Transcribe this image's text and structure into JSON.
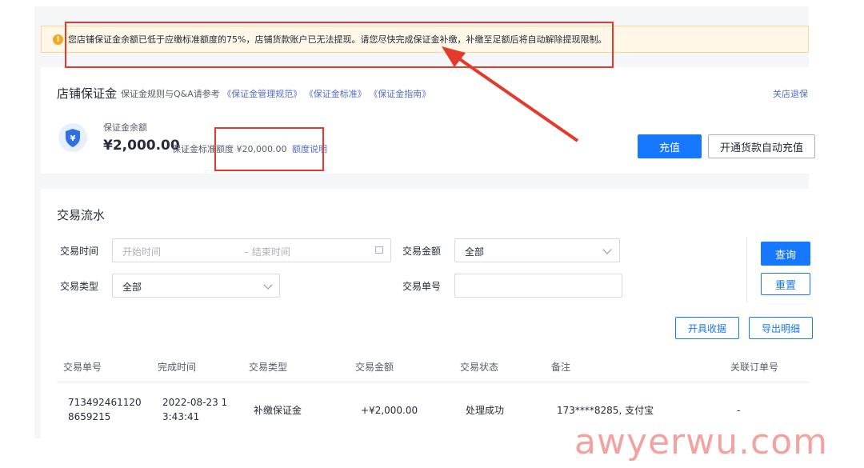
{
  "alert": {
    "icon": "warning-icon",
    "message": "您店铺保证金余额已低于应缴标准额度的75%，店铺货款账户已无法提现。请您尽快完成保证金补缴，补缴至足额后将自动解除提现限制。"
  },
  "deposit": {
    "title": "店铺保证金",
    "rules_prefix": "保证金规则与Q&A请参考",
    "links": [
      "《保证金管理规范》",
      "《保证金标准》",
      "《保证金指南》"
    ],
    "close_store_link": "关店退保",
    "balance_label": "保证金余额",
    "balance_value": "¥2,000.00",
    "standard_label": "保证金标准额度",
    "standard_value": "¥20,000.00",
    "quota_link": "额度说明",
    "recharge_button": "充值",
    "auto_recharge_button": "开通货款自动充值"
  },
  "transactions": {
    "title": "交易流水",
    "filters": {
      "time_label": "交易时间",
      "start_placeholder": "开始时间",
      "end_placeholder": "– 结束时间",
      "amount_label": "交易金额",
      "amount_value": "全部",
      "type_label": "交易类型",
      "type_value": "全部",
      "order_label": "交易单号",
      "order_value": ""
    },
    "query_button": "查询",
    "reset_button": "重置",
    "receipt_button": "开具收据",
    "export_button": "导出明细",
    "columns": [
      "交易单号",
      "完成时间",
      "交易类型",
      "交易金额",
      "交易状态",
      "备注",
      "关联订单号"
    ],
    "rows": [
      {
        "order_no_line1": "713492461120",
        "order_no_line2": "8659215",
        "time_line1": "2022-08-23 1",
        "time_line2": "3:43:41",
        "type": "补缴保证金",
        "amount": "+¥2,000.00",
        "status": "处理成功",
        "note": "173****8285, 支付宝",
        "related": "-"
      }
    ]
  },
  "watermark": "awyerwu.com",
  "colors": {
    "primary": "#1677ff",
    "annotation": "#e4392b",
    "alert_bg": "#fff7e8"
  }
}
